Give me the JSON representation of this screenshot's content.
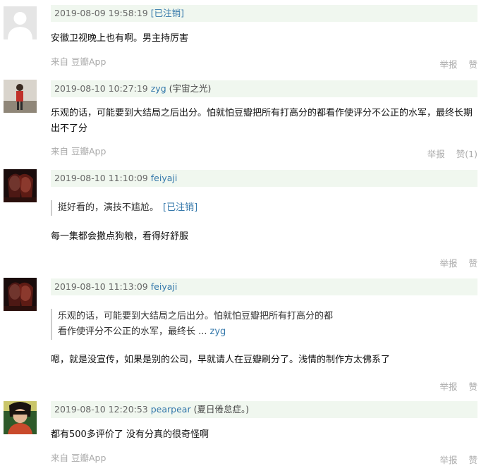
{
  "comments": [
    {
      "time": "2019-08-09 19:58:19",
      "user": "[已注销]",
      "nick": "",
      "text": "安徽卫视晚上也有啊。男主持厉害",
      "source": "来自 豆瓣App",
      "report": "举报",
      "like": "赞"
    },
    {
      "time": "2019-08-10 10:27:19",
      "user": "zyg",
      "nick": "(宇宙之光)",
      "text": "乐观的话，可能要到大结局之后出分。怕就怕豆瓣把所有打高分的都看作使评分不公正的水军，最终长期出不了分",
      "source": "来自 豆瓣App",
      "report": "举报",
      "like": "赞(1)"
    },
    {
      "time": "2019-08-10 11:10:09",
      "user": "feiyaji",
      "nick": "",
      "quote": "挺好看的，演技不尴尬。",
      "quote_user": "[已注销]",
      "text": "每一集都会撒点狗粮，看得好舒服",
      "report": "举报",
      "like": "赞"
    },
    {
      "time": "2019-08-10 11:13:09",
      "user": "feiyaji",
      "nick": "",
      "quote_line1": "乐观的话，可能要到大结局之后出分。怕就怕豆瓣把所有打高分的都",
      "quote_line2": "看作使评分不公正的水军，最终长 ...",
      "quote_user": "zyg",
      "text": "嗯，就是没宣传，如果是别的公司，早就请人在豆瓣刷分了。浅情的制作方太佛系了",
      "report": "举报",
      "like": "赞"
    },
    {
      "time": "2019-08-10 12:20:53",
      "user": "pearpear",
      "nick": "(夏日倦怠症。)",
      "text": "都有500多评价了 没有分真的很奇怪啊",
      "source": "来自 豆瓣App",
      "report": "举报",
      "like": "赞"
    }
  ]
}
